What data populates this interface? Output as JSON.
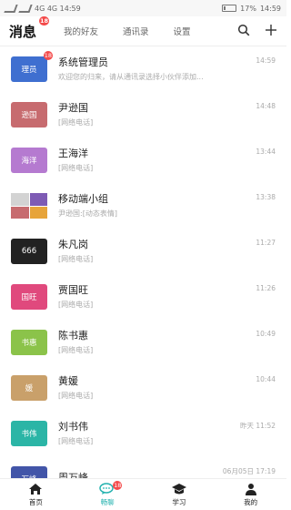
{
  "status_bar": {
    "left": "4G 4G 14:59",
    "battery": "17%",
    "time": "14:59"
  },
  "header": {
    "tabs": [
      {
        "label": "消息",
        "badge": "18",
        "active": true
      },
      {
        "label": "我的好友"
      },
      {
        "label": "通讯录"
      },
      {
        "label": "设置"
      }
    ],
    "icons": [
      "search-icon",
      "plus-icon"
    ]
  },
  "conversations": [
    {
      "name": "系统管理员",
      "preview": "欢迎您的归来，请从通讯录选择小伙伴添加...",
      "time": "14:59",
      "avatar_text": "理员",
      "avatar_color": "#3f6fd0",
      "badge": "18"
    },
    {
      "name": "尹逊国",
      "preview": "[网络电话]",
      "time": "14:48",
      "avatar_text": "逊国",
      "avatar_color": "#c76b6f"
    },
    {
      "name": "王海洋",
      "preview": "[网络电话]",
      "time": "13:44",
      "avatar_text": "海洋",
      "avatar_color": "#b57ad0"
    },
    {
      "name": "移动端小组",
      "preview": "尹逊国:[动态表情]",
      "time": "13:38",
      "avatar_text": "",
      "avatar_color": "#cccccc",
      "group_colors": [
        "#d3d3d3",
        "#7e5bb4",
        "#c76b6f",
        "#e7a43a"
      ]
    },
    {
      "name": "朱凡岗",
      "preview": "[网络电话]",
      "time": "11:27",
      "avatar_text": "666",
      "avatar_color": "#222222"
    },
    {
      "name": "贾国旺",
      "preview": "[网络电话]",
      "time": "11:26",
      "avatar_text": "国旺",
      "avatar_color": "#e0497d"
    },
    {
      "name": "陈书惠",
      "preview": "[网络电话]",
      "time": "10:49",
      "avatar_text": "书惠",
      "avatar_color": "#8bc34a"
    },
    {
      "name": "黄媛",
      "preview": "[网络电话]",
      "time": "10:44",
      "avatar_text": "媛",
      "avatar_color": "#c9a06a"
    },
    {
      "name": "刘书伟",
      "preview": "[网络电话]",
      "time": "昨天 11:52",
      "avatar_text": "书伟",
      "avatar_color": "#2bb5a6"
    },
    {
      "name": "周万峰",
      "preview": "",
      "time": "06月05日 17:19",
      "avatar_text": "万峰",
      "avatar_color": "#4255a8"
    }
  ],
  "bottom_nav": [
    {
      "label": "首页",
      "icon": "home-icon"
    },
    {
      "label": "畅聊",
      "icon": "chat-icon",
      "badge": "18",
      "active": true
    },
    {
      "label": "学习",
      "icon": "graduation-cap-icon"
    },
    {
      "label": "我的",
      "icon": "user-icon"
    }
  ],
  "colors": {
    "accent": "#26b3b0",
    "badge": "#f44a4a"
  }
}
